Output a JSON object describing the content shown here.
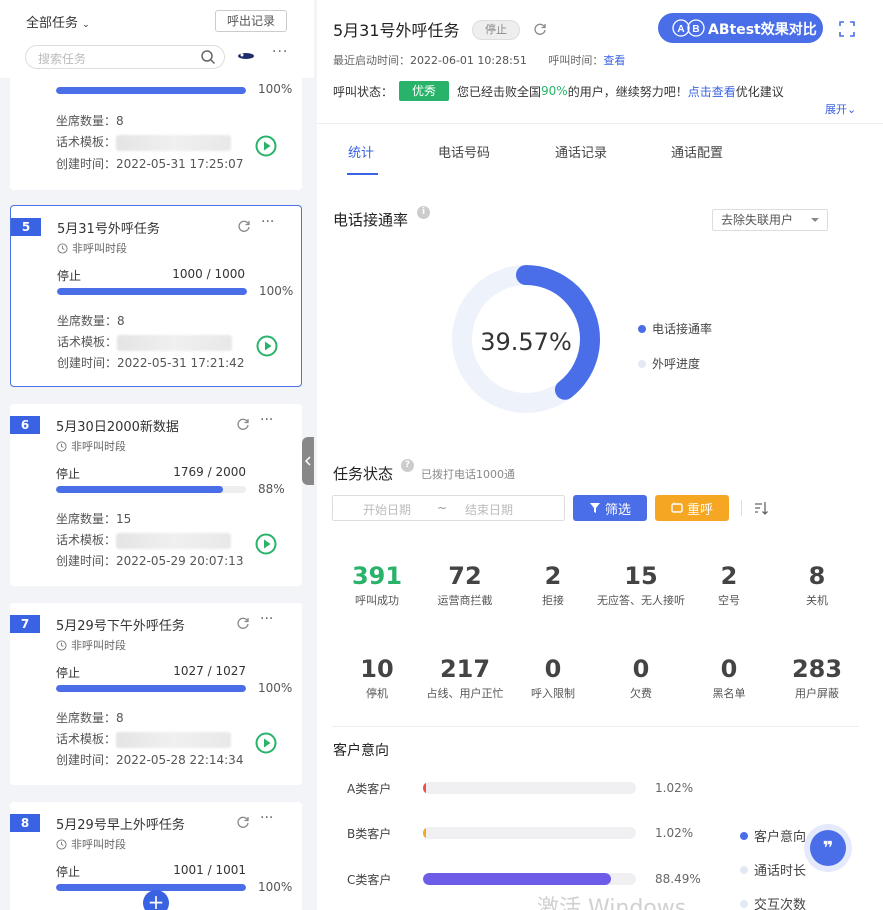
{
  "left": {
    "all_tasks": "全部任务",
    "call_records": "呼出记录",
    "search_placeholder": "搜索任务",
    "top_partial": {
      "pct": "100%",
      "seats": "坐席数量：8",
      "template_label": "话术模板：",
      "created": "创建时间：2022-05-31 17:25:07"
    },
    "cards": [
      {
        "num": "5",
        "title": "5月31号外呼任务",
        "sub": "非呼叫时段",
        "status": "停止",
        "count": "1000 / 1000",
        "progress": 1.0,
        "pct": "100%",
        "seats": "坐席数量：8",
        "template_label": "话术模板：",
        "created": "创建时间：2022-05-31 17:21:42"
      },
      {
        "num": "6",
        "title": "5月30日2000新数据",
        "sub": "非呼叫时段",
        "status": "停止",
        "count": "1769 / 2000",
        "progress": 0.88,
        "pct": "88%",
        "seats": "坐席数量：15",
        "template_label": "话术模板：",
        "created": "创建时间：2022-05-29 20:07:13"
      },
      {
        "num": "7",
        "title": "5月29号下午外呼任务",
        "sub": "非呼叫时段",
        "status": "停止",
        "count": "1027 / 1027",
        "progress": 1.0,
        "pct": "100%",
        "seats": "坐席数量：8",
        "template_label": "话术模板：",
        "created": "创建时间：2022-05-28 22:14:34"
      },
      {
        "num": "8",
        "title": "5月29号早上外呼任务",
        "sub": "非呼叫时段",
        "status": "停止",
        "count": "1001 / 1001",
        "progress": 1.0,
        "pct": "100%"
      }
    ]
  },
  "header": {
    "title": "5月31号外呼任务",
    "state_badge": "停止",
    "ab_button": "ABtest效果对比",
    "ab_a": "A",
    "ab_b": "B",
    "last_start_label": "最近启动时间：",
    "last_start_value": "2022-06-01 10:28:51",
    "call_time_label": "呼叫时间：",
    "call_time_link": "查看",
    "call_status_label": "呼叫状态：",
    "call_status_badge": "优秀",
    "status_msg_1": "您已经击败全国",
    "status_msg_pct": "90%",
    "status_msg_2": "的用户，继续努力吧！",
    "status_msg_link": "点击查看",
    "status_msg_3": "优化建议",
    "expand": "展开"
  },
  "tabs": [
    {
      "label": "统计",
      "active": true
    },
    {
      "label": "电话号码",
      "active": false
    },
    {
      "label": "通话记录",
      "active": false
    },
    {
      "label": "通话配置",
      "active": false
    }
  ],
  "connect_rate": {
    "title": "电话接通率",
    "filter_value": "去除失联用户",
    "value_label": "39.57%",
    "legend": [
      "电话接通率",
      "外呼进度"
    ]
  },
  "chart_data": {
    "type": "pie",
    "values": [
      39.57,
      60.43
    ],
    "categories": [
      "电话接通率",
      ""
    ],
    "colors": [
      "#4a6ee8",
      "#eef2fb"
    ]
  },
  "task_status": {
    "title": "任务状态",
    "note": "已拨打电话1000通",
    "date_start": "开始日期",
    "date_sep": "~",
    "date_end": "结束日期",
    "filter_btn": "筛选",
    "reset_btn": "重呼",
    "stats": [
      {
        "num": "391",
        "label": "呼叫成功"
      },
      {
        "num": "72",
        "label": "运营商拦截"
      },
      {
        "num": "2",
        "label": "拒接"
      },
      {
        "num": "15",
        "label": "无应答、无人接听"
      },
      {
        "num": "2",
        "label": "空号"
      },
      {
        "num": "8",
        "label": "关机"
      },
      {
        "num": "10",
        "label": "停机"
      },
      {
        "num": "217",
        "label": "占线、用户正忙"
      },
      {
        "num": "0",
        "label": "呼入限制"
      },
      {
        "num": "0",
        "label": "欠费"
      },
      {
        "num": "0",
        "label": "黑名单"
      },
      {
        "num": "283",
        "label": "用户屏蔽"
      }
    ]
  },
  "intent": {
    "title": "客户意向",
    "rows": [
      {
        "label": "A类客户",
        "value": 1.02,
        "pct": "1.02%",
        "color": "#f04d4d"
      },
      {
        "label": "B类客户",
        "value": 1.02,
        "pct": "1.02%",
        "color": "#f5a623"
      },
      {
        "label": "C类客户",
        "value": 88.49,
        "pct": "88.49%",
        "color": "#6c5ce7"
      }
    ],
    "legend": [
      "客户意向",
      "通话时长",
      "交互次数"
    ]
  },
  "watermark": "激活 Windows"
}
